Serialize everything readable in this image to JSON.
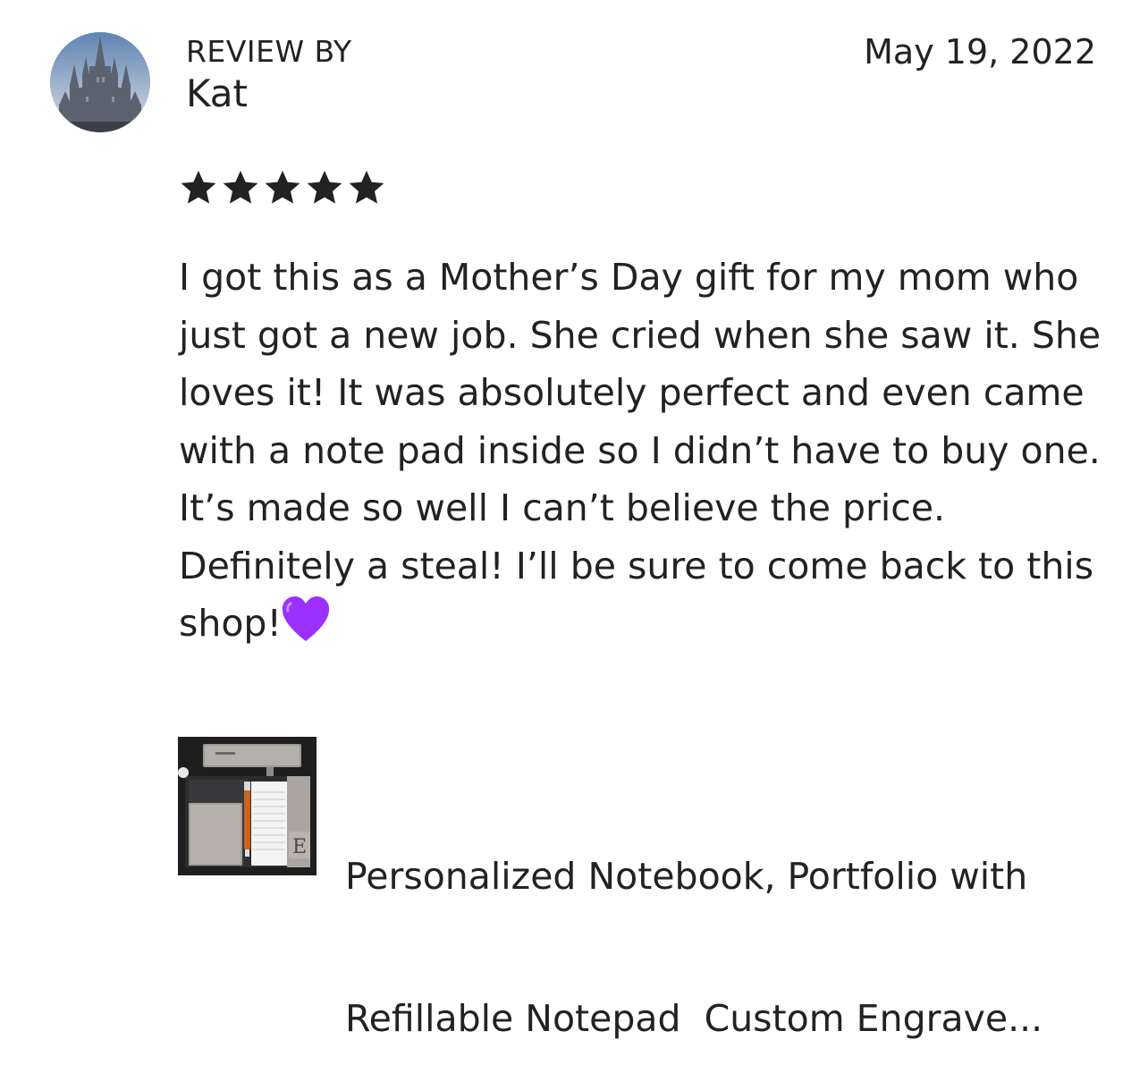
{
  "review": {
    "label": "REVIEW BY",
    "reviewer": "Kat",
    "date": "May 19, 2022",
    "rating": 5,
    "rating_max": 5,
    "text": "I got this as a Mother’s Day gift for my mom who just got a new job. She cried when she saw it. She loves it! It was absolutely perfect and even came with a note pad inside so I didn’t have to buy one. It’s made so well I can’t believe the price. Definitely a steal! I’ll be sure to come back to this shop!"
  },
  "avatar": {
    "icon": "castle-photo-avatar"
  },
  "product": {
    "title_line_1": "Personalized Notebook, Portfolio with",
    "title_line_2": "Refillable Notepad  Custom Engrave...",
    "thumbnail_icon": "notebook-portfolio-thumbnail",
    "thumbnail_monogram": "E"
  },
  "colors": {
    "text": "#222222",
    "star": "#222222",
    "heart": "#9b30ff"
  }
}
